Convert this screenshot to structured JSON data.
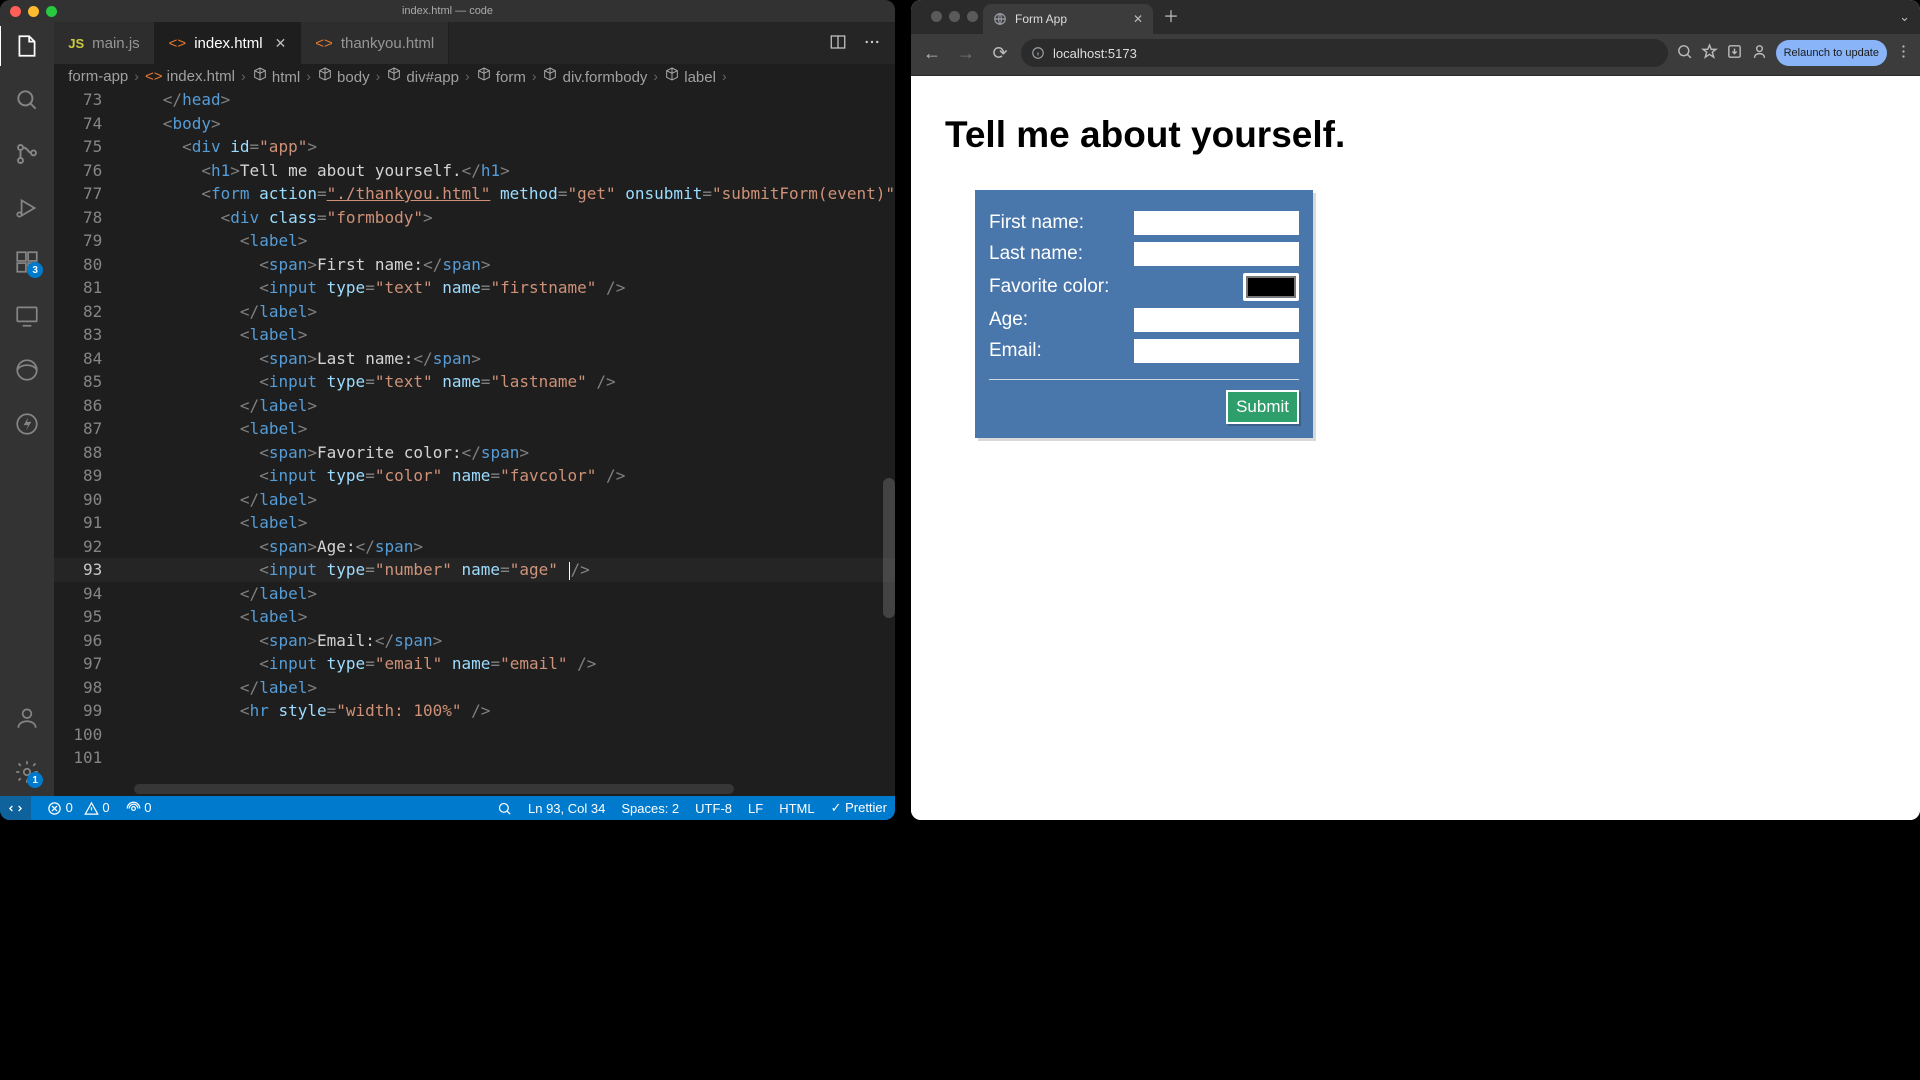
{
  "vscode": {
    "window_title": "index.html — code",
    "tabs": [
      {
        "icon": "js",
        "label": "main.js",
        "active": false,
        "dirty": false
      },
      {
        "icon": "html",
        "label": "index.html",
        "active": true,
        "close": true
      },
      {
        "icon": "html",
        "label": "thankyou.html",
        "active": false
      }
    ],
    "breadcrumb": [
      {
        "icon": "folder",
        "label": "form-app"
      },
      {
        "icon": "html",
        "label": "index.html"
      },
      {
        "icon": "cube",
        "label": "html"
      },
      {
        "icon": "cube",
        "label": "body"
      },
      {
        "icon": "cube",
        "label": "div#app"
      },
      {
        "icon": "cube",
        "label": "form"
      },
      {
        "icon": "cube",
        "label": "div.formbody"
      },
      {
        "icon": "cube",
        "label": "label"
      }
    ],
    "activity_badges": {
      "extensions": "3",
      "settings": "1"
    },
    "code": {
      "first_line_number": 73,
      "current_line_number": 93,
      "lines": [
        "    </head>",
        "    <body>",
        "      <div id=\"app\">",
        "        <h1>Tell me about yourself.</h1>",
        "        <form action=\"./thankyou.html\" method=\"get\" onsubmit=\"submitForm(event)\"",
        "          <div class=\"formbody\">",
        "            <label>",
        "              <span>First name:</span>",
        "              <input type=\"text\" name=\"firstname\" />",
        "            </label>",
        "            <label>",
        "              <span>Last name:</span>",
        "              <input type=\"text\" name=\"lastname\" />",
        "            </label>",
        "            <label>",
        "              <span>Favorite color:</span>",
        "              <input type=\"color\" name=\"favcolor\" />",
        "            </label>",
        "            <label>",
        "              <span>Age:</span>",
        "              <input type=\"number\" name=\"age\" |/>",
        "            </label>",
        "",
        "            <label>",
        "              <span>Email:</span>",
        "              <input type=\"email\" name=\"email\" />",
        "            </label>",
        "",
        "            <hr style=\"width: 100%\" />"
      ]
    },
    "status": {
      "errors": "0",
      "warnings": "0",
      "ports": "0",
      "cursor": "Ln 93, Col 34",
      "spaces": "Spaces: 2",
      "encoding": "UTF-8",
      "eol": "LF",
      "language": "HTML",
      "formatter": "Prettier"
    }
  },
  "chrome": {
    "tab_title": "Form App",
    "url": "localhost:5173",
    "relaunch": "Relaunch to update",
    "page": {
      "heading": "Tell me about yourself.",
      "fields": [
        {
          "label": "First name:",
          "type": "text",
          "name": "firstname"
        },
        {
          "label": "Last name:",
          "type": "text",
          "name": "lastname"
        },
        {
          "label": "Favorite color:",
          "type": "color",
          "name": "favcolor"
        },
        {
          "label": "Age:",
          "type": "number",
          "name": "age"
        },
        {
          "label": "Email:",
          "type": "email",
          "name": "email"
        }
      ],
      "submit": "Submit"
    }
  }
}
